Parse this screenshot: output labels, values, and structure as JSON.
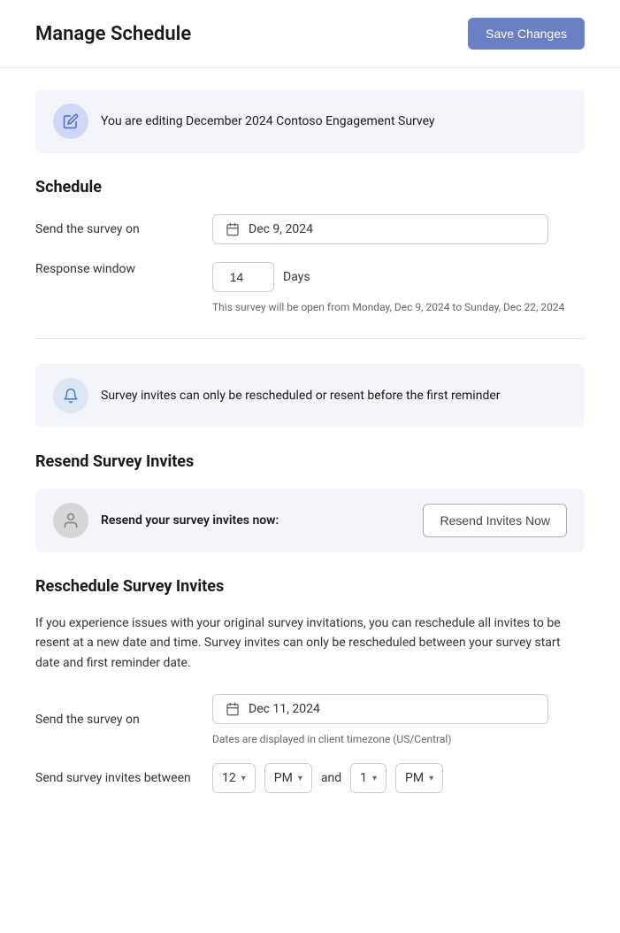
{
  "header": {
    "title": "Manage Schedule",
    "save_button_label": "Save Changes"
  },
  "editing_banner": {
    "text": "You are editing December 2024 Contoso Engagement Survey",
    "icon": "pencil"
  },
  "schedule_section": {
    "title": "Schedule",
    "send_on_label": "Send the survey on",
    "send_on_value": "Dec 9, 2024",
    "response_window_label": "Response window",
    "response_window_value": "14",
    "response_window_unit": "Days",
    "response_window_helper": "This survey will be open from Monday, Dec 9, 2024 to Sunday, Dec 22, 2024"
  },
  "reminder_banner": {
    "text": "Survey invites can only be rescheduled or resent before the first reminder",
    "icon": "bell"
  },
  "resend_section": {
    "title": "Resend Survey Invites",
    "label": "Resend your survey invites now:",
    "button_label": "Resend Invites Now",
    "icon": "person"
  },
  "reschedule_section": {
    "title": "Reschedule Survey Invites",
    "description": "If you experience issues with your original survey invitations, you can reschedule all invites to be resent at a new date and time. Survey invites can only be rescheduled between your survey start date and first reminder date.",
    "send_on_label": "Send the survey on",
    "send_on_value": "Dec 11, 2024",
    "timezone_helper": "Dates are displayed in client timezone (US/Central)",
    "send_between_label": "Send survey invites between",
    "hour_start": "12",
    "ampm_start": "PM",
    "and_text": "and",
    "hour_end": "1",
    "ampm_end": "PM"
  }
}
